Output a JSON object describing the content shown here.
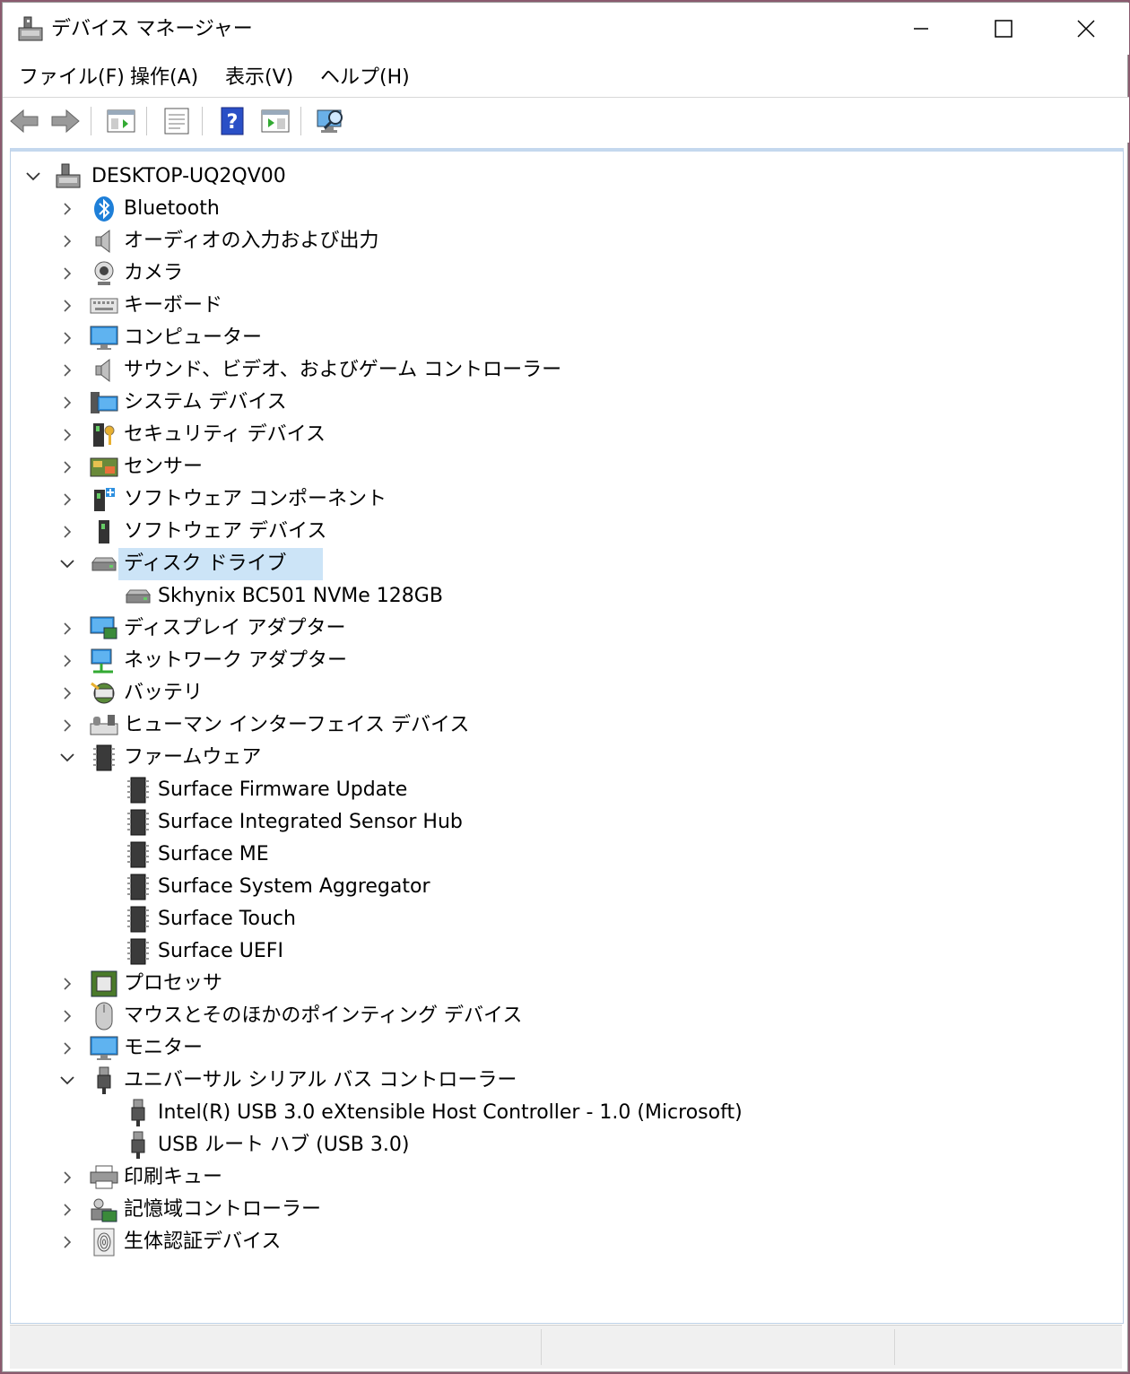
{
  "window": {
    "title": "デバイス マネージャー"
  },
  "menubar": {
    "items": [
      "ファイル(F)",
      "操作(A)",
      "表示(V)",
      "ヘルプ(H)"
    ]
  },
  "toolbar": {
    "buttons": [
      "back-icon",
      "forward-icon",
      "properties-pane-icon",
      "properties-icon",
      "help-icon",
      "run-icon",
      "scan-icon"
    ]
  },
  "tree": {
    "root": "DESKTOP-UQ2QV00",
    "nodes": [
      {
        "label": "Bluetooth",
        "icon": "bluetooth-icon",
        "expanded": false
      },
      {
        "label": "オーディオの入力および出力",
        "icon": "speaker-icon",
        "expanded": false
      },
      {
        "label": "カメラ",
        "icon": "camera-icon",
        "expanded": false
      },
      {
        "label": "キーボード",
        "icon": "keyboard-icon",
        "expanded": false
      },
      {
        "label": "コンピューター",
        "icon": "monitor-icon",
        "expanded": false
      },
      {
        "label": "サウンド、ビデオ、およびゲーム コントローラー",
        "icon": "speaker-icon",
        "expanded": false
      },
      {
        "label": "システム デバイス",
        "icon": "system-icon",
        "expanded": false
      },
      {
        "label": "セキュリティ デバイス",
        "icon": "security-icon",
        "expanded": false
      },
      {
        "label": "センサー",
        "icon": "sensor-icon",
        "expanded": false
      },
      {
        "label": "ソフトウェア コンポーネント",
        "icon": "software-component-icon",
        "expanded": false
      },
      {
        "label": "ソフトウェア デバイス",
        "icon": "software-device-icon",
        "expanded": false
      },
      {
        "label": "ディスク ドライブ",
        "icon": "disk-icon",
        "expanded": true,
        "selected": true,
        "children": [
          {
            "label": "Skhynix BC501 NVMe 128GB",
            "icon": "disk-icon"
          }
        ]
      },
      {
        "label": "ディスプレイ アダプター",
        "icon": "display-adapter-icon",
        "expanded": false
      },
      {
        "label": "ネットワーク アダプター",
        "icon": "network-icon",
        "expanded": false
      },
      {
        "label": "バッテリ",
        "icon": "battery-icon",
        "expanded": false
      },
      {
        "label": "ヒューマン インターフェイス デバイス",
        "icon": "hid-icon",
        "expanded": false
      },
      {
        "label": "ファームウェア",
        "icon": "chip-icon",
        "expanded": true,
        "children": [
          {
            "label": "Surface Firmware Update",
            "icon": "chip-icon"
          },
          {
            "label": "Surface Integrated Sensor Hub",
            "icon": "chip-icon"
          },
          {
            "label": "Surface ME",
            "icon": "chip-icon"
          },
          {
            "label": "Surface System Aggregator",
            "icon": "chip-icon"
          },
          {
            "label": "Surface Touch",
            "icon": "chip-icon"
          },
          {
            "label": "Surface UEFI",
            "icon": "chip-icon"
          }
        ]
      },
      {
        "label": "プロセッサ",
        "icon": "processor-icon",
        "expanded": false
      },
      {
        "label": "マウスとそのほかのポインティング デバイス",
        "icon": "mouse-icon",
        "expanded": false
      },
      {
        "label": "モニター",
        "icon": "monitor-icon",
        "expanded": false
      },
      {
        "label": "ユニバーサル シリアル バス コントローラー",
        "icon": "usb-icon",
        "expanded": true,
        "children": [
          {
            "label": "Intel(R) USB 3.0 eXtensible Host Controller - 1.0 (Microsoft)",
            "icon": "usb-icon"
          },
          {
            "label": "USB ルート ハブ (USB 3.0)",
            "icon": "usb-icon"
          }
        ]
      },
      {
        "label": "印刷キュー",
        "icon": "printer-icon",
        "expanded": false
      },
      {
        "label": "記憶域コントローラー",
        "icon": "storage-controller-icon",
        "expanded": false
      },
      {
        "label": "生体認証デバイス",
        "icon": "fingerprint-icon",
        "expanded": false
      }
    ]
  },
  "colors": {
    "selection": "#cce4f7",
    "accent": "#0078d7"
  }
}
